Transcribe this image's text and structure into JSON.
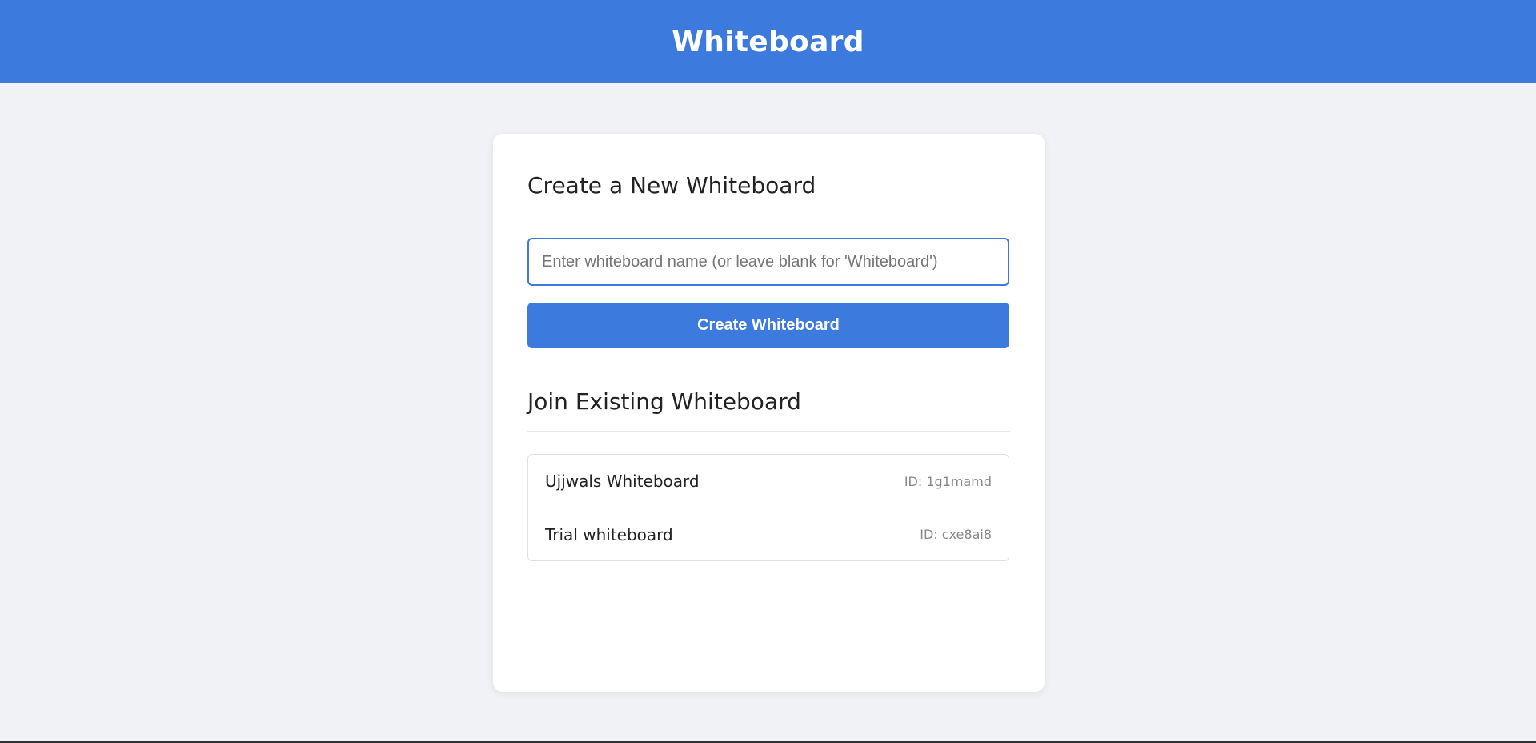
{
  "header": {
    "title": "Whiteboard"
  },
  "create": {
    "title": "Create a New Whiteboard",
    "input_placeholder": "Enter whiteboard name (or leave blank for 'Whiteboard')",
    "button_label": "Create Whiteboard"
  },
  "join": {
    "title": "Join Existing Whiteboard",
    "boards": [
      {
        "name": "Ujjwals Whiteboard",
        "id": "ID: 1g1mamd"
      },
      {
        "name": "Trial whiteboard",
        "id": "ID: cxe8ai8"
      }
    ]
  },
  "colors": {
    "accent": "#3c7add",
    "background": "#f0f2f5"
  }
}
